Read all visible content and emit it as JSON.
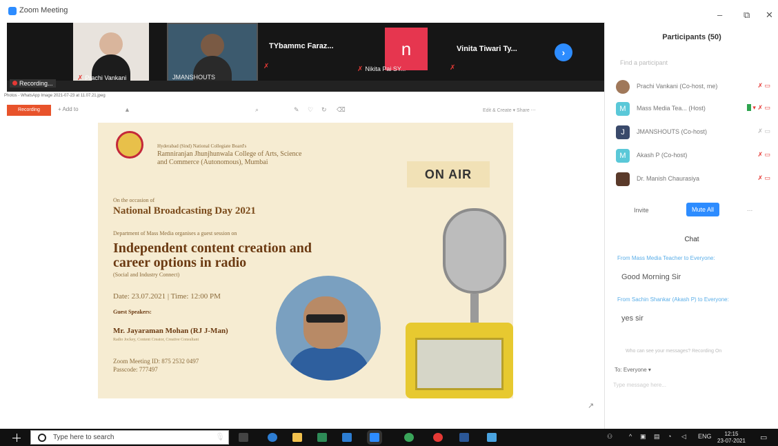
{
  "window": {
    "title": "Zoom Meeting",
    "minimize": "–",
    "restore": "⧉",
    "close": "✕"
  },
  "video_strip": {
    "tiles": [
      {
        "name": "Prachi Vankani"
      },
      {
        "name": "JMANSHOUTS"
      },
      {
        "name": "TYbammc Faraz..."
      },
      {
        "name": "Nikita Pai SY..."
      },
      {
        "name": "Vinita Tiwari Ty..."
      }
    ],
    "n_avatar_letter": "n",
    "next_icon": "chevron-right-icon",
    "recording_label": "Recording..."
  },
  "share": {
    "file_line": "Photos - WhatsApp Image 2021-07-23 at 11.07.21.jpeg",
    "red_button": "Recording",
    "plus_label": "+ Add to",
    "right_tools": "Edit & Create ▾   Share   ⋯",
    "expand_icon": "↗"
  },
  "poster": {
    "college_line1": "Hyderabad (Sind) National Collegiate Board's",
    "college_line2": "Ramniranjan Jhunjhunwala College of Arts, Science",
    "college_line3": "and Commerce (Autonomous), Mumbai",
    "on_air": "ON AIR",
    "occasion": "On the occasion of",
    "event": "National Broadcasting Day 2021",
    "dept": "Department of Mass Media organises a guest session on",
    "headline_line1": "Independent content creation and",
    "headline_line2": "career options in radio",
    "sub": "(Social and Industry Connect)",
    "date": "Date: 23.07.2021  |  Time: 12:00 PM",
    "guest_label": "Guest Speakers:",
    "guest_name": "Mr. Jayaraman Mohan (RJ J-Man)",
    "guest_desc": "Radio Jockey, Content Creator, Creative Consultant",
    "zoom_id": "Zoom Meeting ID: 875 2532 0497",
    "passcode": "Passcode: 777497"
  },
  "panel": {
    "title": "Participants (50)",
    "find_placeholder": "Find a participant",
    "participants": [
      {
        "name": "Prachi Vankani (Co-host, me)",
        "avatar": "",
        "color": "#a0785a",
        "icons": "🎤 ▭"
      },
      {
        "name": "Mass Media Tea... (Host)",
        "avatar": "M",
        "color": "#5ac8d8",
        "icons": "🎤 ▭"
      },
      {
        "name": "JMANSHOUTS (Co-host)",
        "avatar": "J",
        "color": "#3a4a6b",
        "icons": "🎤 ▭"
      },
      {
        "name": "Akash P (Co-host)",
        "avatar": "M",
        "color": "#5ac8d8",
        "icons": "🎤 ▭"
      },
      {
        "name": "Dr. Manish Chaurasiya",
        "avatar": "",
        "color": "#5a3a2a",
        "icons": "🎤 ▭"
      }
    ],
    "invite": "Invite",
    "mute_all": "Mute All",
    "more": "...",
    "chat_title": "Chat",
    "messages": [
      {
        "from": "From Mass Media Teacher to Everyone:",
        "text": "Good Morning Sir"
      },
      {
        "from": "From Sachin Shankar (Akash P) to Everyone:",
        "text": "yes sir"
      }
    ],
    "chat_note": "Who can see your messages? Recording On",
    "to_label": "To:  Everyone ▾",
    "input_placeholder": "Type message here..."
  },
  "taskbar": {
    "search_placeholder": "Type here to search",
    "lang": "ENG",
    "time": "12:15",
    "date": "23-07-2021"
  }
}
